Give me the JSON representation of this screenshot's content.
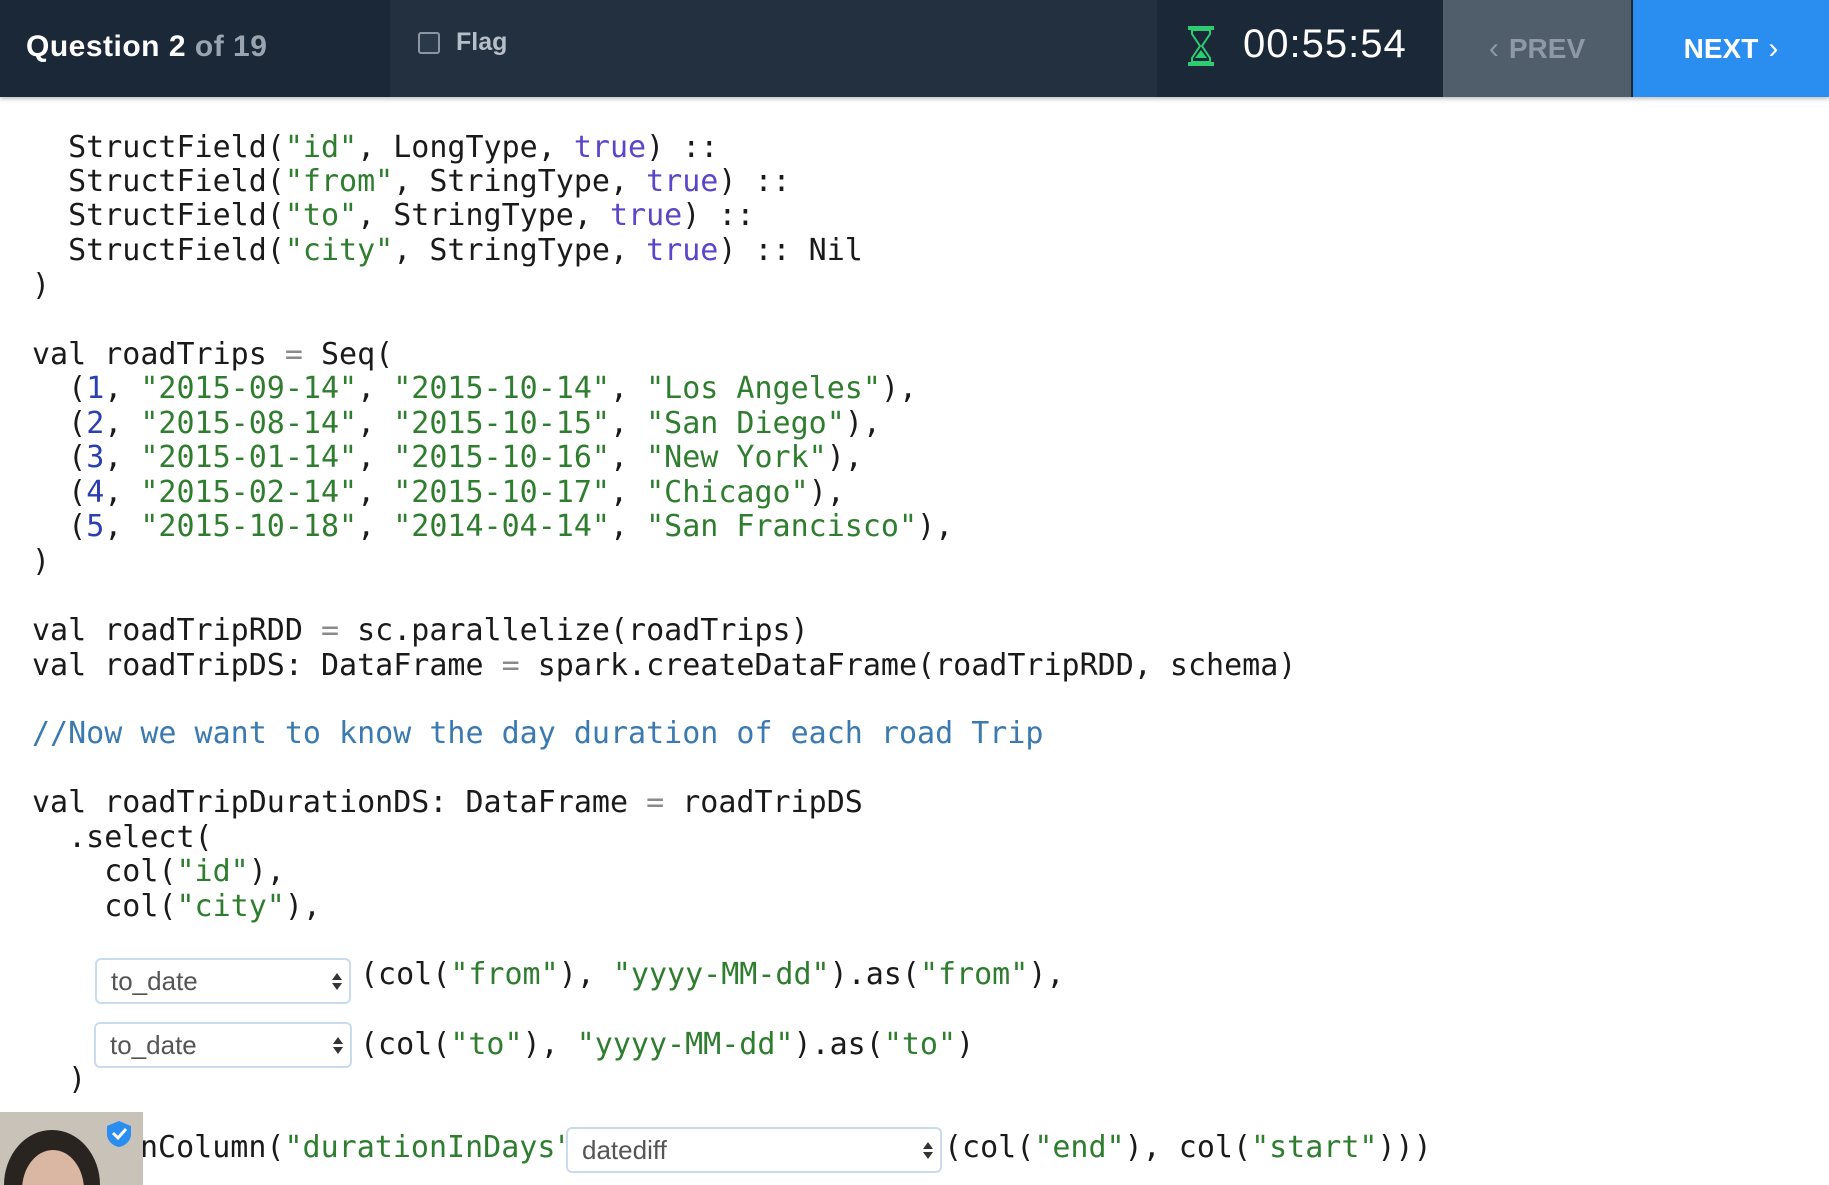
{
  "header": {
    "question_label": "Question 2",
    "question_total": "of 19",
    "flag_label": "Flag",
    "flag_checked": false,
    "timer": "00:55:54",
    "prev_label": "PREV",
    "next_label": "NEXT"
  },
  "code": {
    "l01a": "  StructField(",
    "l01b": "\"id\"",
    "l01c": ", LongType, ",
    "l01d": "true",
    "l01e": ") ::",
    "l02a": "  StructField(",
    "l02b": "\"from\"",
    "l02c": ", StringType, ",
    "l02d": "true",
    "l02e": ") ::",
    "l03a": "  StructField(",
    "l03b": "\"to\"",
    "l03c": ", StringType, ",
    "l03d": "true",
    "l03e": ") ::",
    "l04a": "  StructField(",
    "l04b": "\"city\"",
    "l04c": ", StringType, ",
    "l04d": "true",
    "l04e": ") :: Nil",
    "l05": ")",
    "l06a": "val roadTrips ",
    "l06b": "=",
    "l06c": " Seq(",
    "trips": [
      {
        "id": "1",
        "from": "\"2015-09-14\"",
        "to": "\"2015-10-14\"",
        "city": "\"Los Angeles\""
      },
      {
        "id": "2",
        "from": "\"2015-08-14\"",
        "to": "\"2015-10-15\"",
        "city": "\"San Diego\""
      },
      {
        "id": "3",
        "from": "\"2015-01-14\"",
        "to": "\"2015-10-16\"",
        "city": "\"New York\""
      },
      {
        "id": "4",
        "from": "\"2015-02-14\"",
        "to": "\"2015-10-17\"",
        "city": "\"Chicago\""
      },
      {
        "id": "5",
        "from": "\"2015-10-18\"",
        "to": "\"2014-04-14\"",
        "city": "\"San Francisco\""
      }
    ],
    "l12": ")",
    "l13a": "val roadTripRDD ",
    "l13b": "=",
    "l13c": " sc.parallelize(roadTrips)",
    "l14a": "val roadTripDS: DataFrame ",
    "l14b": "=",
    "l14c": " spark.createDataFrame(roadTripRDD, schema)",
    "l15": "//Now we want to know the day duration of each road Trip",
    "l16a": "val roadTripDurationDS: DataFrame ",
    "l16b": "=",
    "l16c": " roadTripDS",
    "l17": "  .select(",
    "l18a": "    col(",
    "l18b": "\"id\"",
    "l18c": "),",
    "l19a": "    col(",
    "l19b": "\"city\"",
    "l19c": "),",
    "l20a": "(col(",
    "l20b": "\"from\"",
    "l20c": "), ",
    "l20d": "\"yyyy-MM-dd\"",
    "l20e": ").as(",
    "l20f": "\"from\"",
    "l20g": "),",
    "l21a": "(col(",
    "l21b": "\"to\"",
    "l21c": "), ",
    "l21d": "\"yyyy-MM-dd\"",
    "l21e": ").as(",
    "l21f": "\"to\"",
    "l21g": ")",
    "l22": "  )",
    "l23a": "nColumn(",
    "l23b": "\"durationInDays\"",
    "l23c": ",",
    "l23d": "(col(",
    "l23e": "\"end\"",
    "l23f": "), col(",
    "l23g": "\"start\"",
    "l23h": ")))"
  },
  "dropdowns": {
    "d1": "to_date",
    "d2": "to_date",
    "d3": "datediff"
  }
}
